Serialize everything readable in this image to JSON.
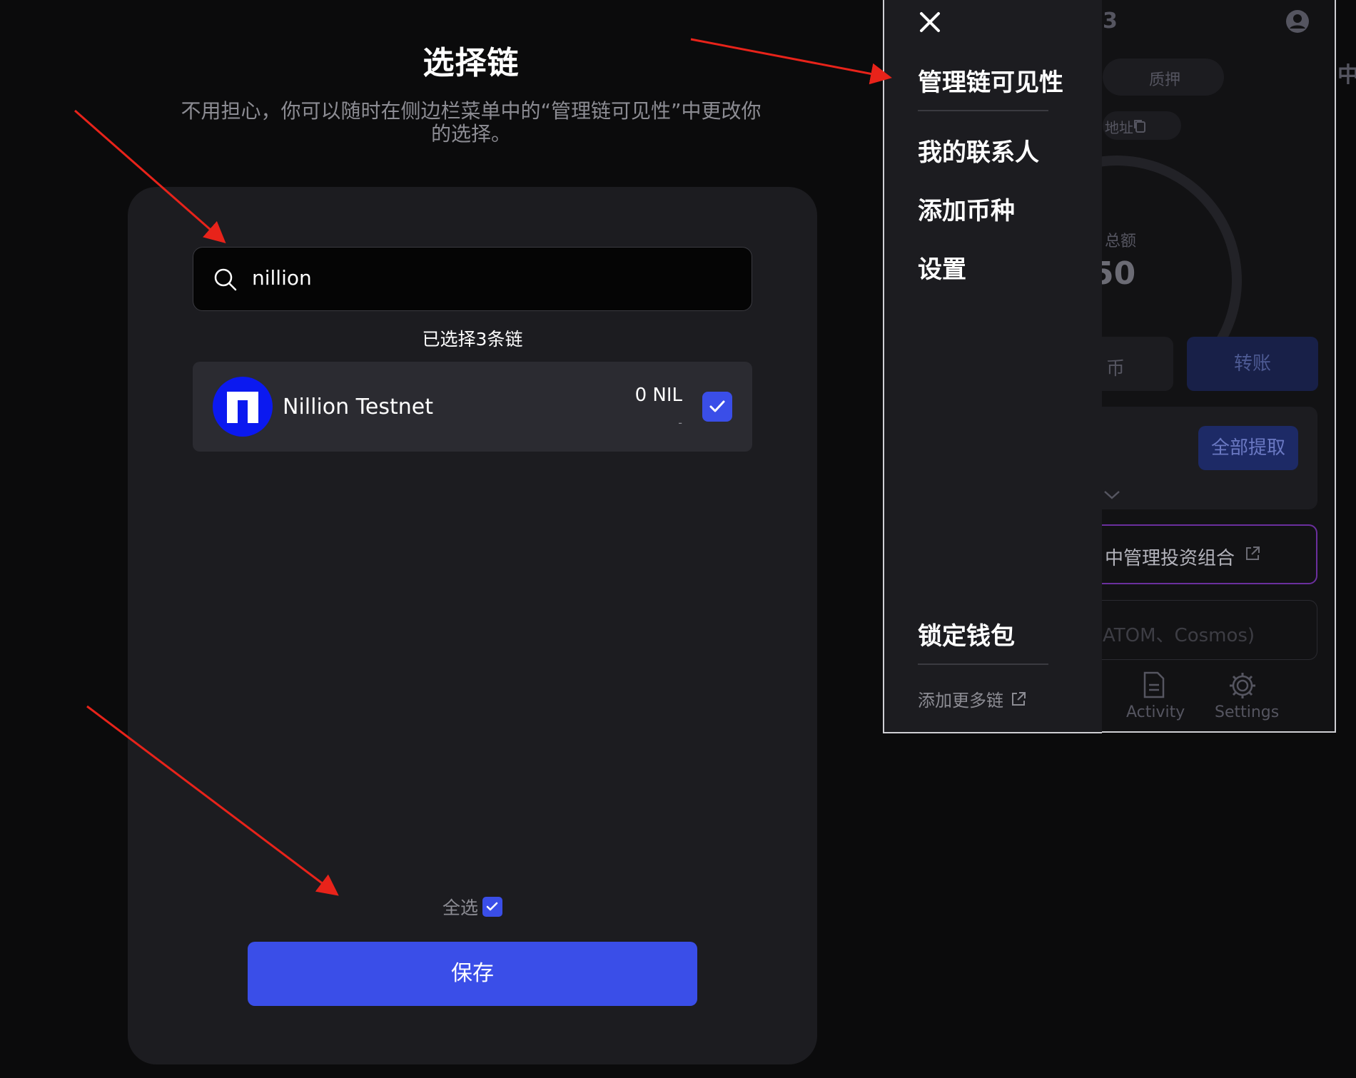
{
  "dialog": {
    "title": "选择链",
    "subtitle": "不用担心，你可以随时在侧边栏菜单中的“管理链可见性”中更改你的选择。",
    "search_value": "nillion",
    "selected_count": "已选择3条链",
    "chains": [
      {
        "name": "Nillion Testnet",
        "balance": "0 NIL",
        "sub": "-",
        "checked": true
      }
    ],
    "select_all_label": "全选",
    "save_label": "保存"
  },
  "side_menu": {
    "items": [
      "管理链可见性",
      "我的联系人",
      "添加币种",
      "设置"
    ],
    "lock_label": "锁定钱包",
    "add_chain_link": "添加更多链"
  },
  "wallet_background": {
    "header_fragment": "3",
    "tab_stake": "质押",
    "address_fragment": "地址",
    "total_fragment": "总额",
    "amount_fragment": "50",
    "coin_fragment": "币",
    "transfer_label": "转账",
    "withdraw_all_label": "全部提取",
    "portfolio_fragment": "中管理投资组合",
    "cosmos_fragment": "ATOM、Cosmos)",
    "nav_activity": "Activity",
    "nav_settings": "Settings",
    "edge_fragment": "中"
  },
  "colors": {
    "accent": "#3a4ee8",
    "card": "#1c1c20",
    "annotation_arrow": "#e8231a",
    "nillion_logo": "#0b19f0"
  }
}
